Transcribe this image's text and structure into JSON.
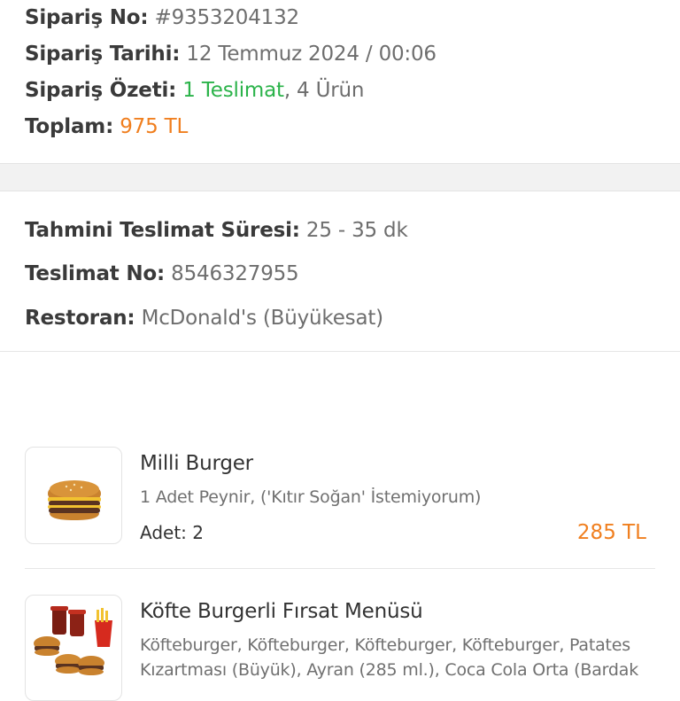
{
  "order": {
    "no_label": "Sipariş No:",
    "no_value": "#9353204132",
    "date_label": "Sipariş Tarihi:",
    "date_value": "12 Temmuz 2024 / 00:06",
    "summary_label": "Sipariş Özeti:",
    "summary_delivery": "1 Teslimat",
    "summary_items": ", 4 Ürün",
    "total_label": "Toplam:",
    "total_value": "975 TL"
  },
  "delivery": {
    "time_label": "Tahmini Teslimat Süresi:",
    "time_value": "25 - 35 dk",
    "no_label": "Teslimat No:",
    "no_value": "8546327955",
    "restaurant_label": "Restoran:",
    "restaurant_value": "McDonald's (Büyükesat)"
  },
  "products": [
    {
      "name": "Milli Burger",
      "description": "1 Adet Peynir, ('Kıtır Soğan' İstemiyorum)",
      "qty_label": "Adet:",
      "qty_value": "2",
      "price": "285 TL",
      "image_icon": "burger-icon"
    },
    {
      "name": "Köfte Burgerli Fırsat Menüsü",
      "description": "Köfteburger, Köfteburger, Köfteburger, Köfteburger, Patates Kızartması (Büyük), Ayran (285 ml.), Coca Cola Orta (Bardak",
      "image_icon": "burger-menu-icon"
    }
  ],
  "colors": {
    "accent_orange": "#f07f1f",
    "accent_green": "#2bb34a"
  }
}
